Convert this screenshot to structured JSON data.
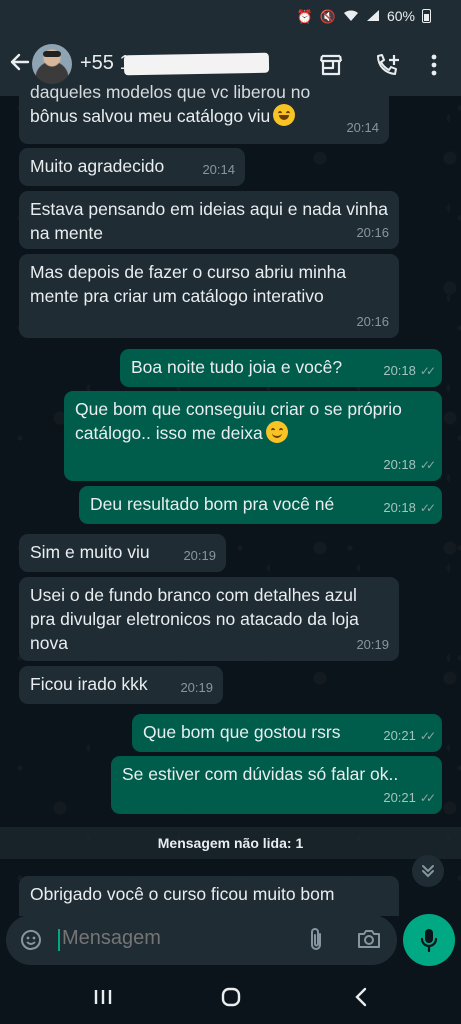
{
  "status_bar": {
    "battery": "60%"
  },
  "header": {
    "contact_prefix": "+55 1"
  },
  "messages": [
    {
      "dir": "in",
      "text": "daqueles modelos que vc liberou no",
      "time": ""
    },
    {
      "dir": "in",
      "text": "bônus salvou meu catálogo viu",
      "time": "20:14",
      "emoji": "laugh"
    },
    {
      "dir": "in",
      "text": "Muito agradecido",
      "time": "20:14"
    },
    {
      "dir": "in",
      "text": "Estava pensando em ideias aqui e nada vinha na mente",
      "time": "20:16"
    },
    {
      "dir": "in",
      "text": "Mas depois de fazer o curso  abriu minha mente pra criar um catálogo interativo",
      "time": "20:16"
    },
    {
      "dir": "out",
      "text": "Boa noite tudo joia e você?",
      "time": "20:18"
    },
    {
      "dir": "out",
      "text": "Que bom que conseguiu criar o se próprio catálogo.. isso me deixa",
      "time": "20:18",
      "emoji": "blush"
    },
    {
      "dir": "out",
      "text": "Deu resultado bom pra você  né",
      "time": "20:18"
    },
    {
      "dir": "in",
      "text": "Sim e muito viu",
      "time": "20:19"
    },
    {
      "dir": "in",
      "text": "Usei o de fundo branco com detalhes azul pra divulgar eletronicos no atacado da loja nova",
      "time": "20:19"
    },
    {
      "dir": "in",
      "text": "Ficou irado kkk",
      "time": "20:19"
    },
    {
      "dir": "out",
      "text": "Que bom que gostou rsrs",
      "time": "20:21"
    },
    {
      "dir": "out",
      "text": "Se estiver com dúvidas só falar ok..",
      "time": "20:21"
    },
    {
      "dir": "in",
      "text": "Obrigado você o curso ficou muito bom",
      "time": ""
    }
  ],
  "unread_divider": "Mensagem não lida: 1",
  "input": {
    "placeholder": "Mensagem"
  },
  "colors": {
    "incoming": "#1f2c34",
    "outgoing": "#005c4b",
    "accent": "#00a884",
    "background": "#0b141a"
  },
  "icons": [
    "back-arrow-icon",
    "store-icon",
    "call-add-icon",
    "kebab-menu-icon",
    "sticker-icon",
    "attach-icon",
    "camera-icon",
    "mic-icon",
    "double-check-icon",
    "chevron-down-icon"
  ]
}
